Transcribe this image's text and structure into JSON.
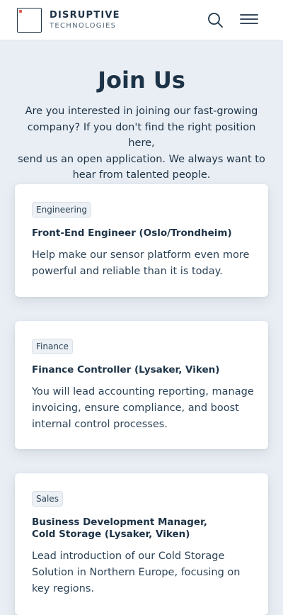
{
  "header": {
    "brand_name": "DISRUPTIVE",
    "brand_sub": "TECHNOLOGIES",
    "search_icon": "search-icon",
    "menu_icon": "hamburger-menu-icon",
    "accent_color": "#e85a4f"
  },
  "main": {
    "title": "Join Us",
    "intro_lines": [
      "Are you interested in joining our fast-growing",
      "company? If you don't find the right position here,",
      "send us an open application. We always want to",
      "hear from talented people."
    ]
  },
  "jobs": [
    {
      "tag": "Engineering",
      "title_lines": [
        "Front-End Engineer (Oslo/Trondheim)"
      ],
      "desc_lines": [
        "Help make our sensor platform even more",
        "powerful and reliable than it is today."
      ]
    },
    {
      "tag": "Finance",
      "title_lines": [
        "Finance Controller (Lysaker, Viken)"
      ],
      "desc_lines": [
        "You will lead accounting reporting, manage",
        "invoicing, ensure compliance, and boost",
        "internal control processes."
      ]
    },
    {
      "tag": "Sales",
      "title_lines": [
        "Business Development Manager,",
        "Cold Storage (Lysaker, Viken)"
      ],
      "desc_lines": [
        "Lead introduction of our Cold Storage",
        "Solution in Northern Europe, focusing on",
        "key regions."
      ]
    }
  ]
}
